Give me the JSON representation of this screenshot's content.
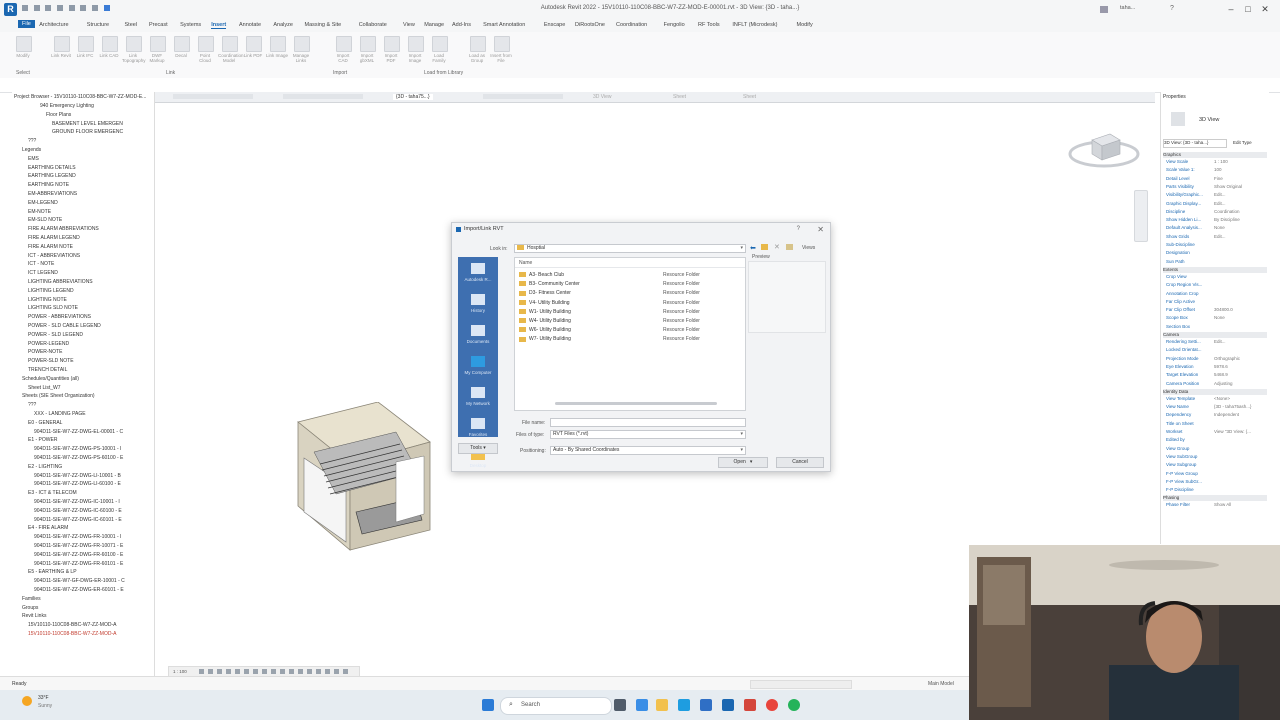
{
  "app": {
    "logo": "R",
    "window_title": "Autodesk Revit 2022 - 15V10110-110C08-BBC-W7-ZZ-MOD-E-00001.rvt - 3D View: {3D - taha...}",
    "user": "taha..."
  },
  "ribbon_tabs": [
    "File",
    "Architecture",
    "Structure",
    "Steel",
    "Precast",
    "Systems",
    "Insert",
    "Annotate",
    "Analyze",
    "Massing & Site",
    "Collaborate",
    "View",
    "Manage",
    "Add-Ins",
    "Smart Annotation",
    "Enscape",
    "DiRootsOne",
    "Coordination",
    "Fengolio",
    "RF Tools",
    "INFLT (Microdesk)",
    "Modify"
  ],
  "ribbon_active_tab": "Insert",
  "ribbon_groups": {
    "select": "Select",
    "link": "Link",
    "import": "Import",
    "load": "Load from Library"
  },
  "ribbon_tools": [
    "Modify",
    "Link Revit",
    "Link IFC",
    "Link CAD",
    "Link Topography",
    "DWF Markup",
    "Decal",
    "Point Cloud",
    "Coordination Model",
    "Link PDF",
    "Link Image",
    "Manage Links",
    "Import CAD",
    "Import gbXML",
    "Import PDF",
    "Import Image",
    "Load Family",
    "Load as Group",
    "Insert from File"
  ],
  "view_tabs": [
    "{3D - taha75...}",
    "3D View",
    "Sheet"
  ],
  "project_browser": {
    "title": "Project Browser - 15V10110-110C08-BBC-W7-ZZ-MOD-E...",
    "items": [
      {
        "label": "940 Emergency Lighting",
        "indent": 4,
        "red": false
      },
      {
        "label": "Floor Plans",
        "indent": 5,
        "red": false
      },
      {
        "label": "BASEMENT LEVEL EMERGEN",
        "indent": 6,
        "red": false
      },
      {
        "label": "GROUND FLOOR EMERGENC",
        "indent": 6,
        "red": false
      },
      {
        "label": "???",
        "indent": 2,
        "red": false
      },
      {
        "label": "Legends",
        "indent": 1,
        "red": false
      },
      {
        "label": "EMS",
        "indent": 2,
        "red": false
      },
      {
        "label": "EARTHING DETAILS",
        "indent": 2,
        "red": false
      },
      {
        "label": "EARTHING LEGEND",
        "indent": 2,
        "red": false
      },
      {
        "label": "EARTHING NOTE",
        "indent": 2,
        "red": false
      },
      {
        "label": "EM-ABBREVIATIONS",
        "indent": 2,
        "red": false
      },
      {
        "label": "EM-LEGEND",
        "indent": 2,
        "red": false
      },
      {
        "label": "EM-NOTE",
        "indent": 2,
        "red": false
      },
      {
        "label": "EM-SLD NOTE",
        "indent": 2,
        "red": false
      },
      {
        "label": "FIRE ALARM ABBREVIATIONS",
        "indent": 2,
        "red": false
      },
      {
        "label": "FIRE ALARM LEGEND",
        "indent": 2,
        "red": false
      },
      {
        "label": "FIRE ALARM NOTE",
        "indent": 2,
        "red": false
      },
      {
        "label": "ICT - ABBREVIATIONS",
        "indent": 2,
        "red": false
      },
      {
        "label": "ICT - NOTE",
        "indent": 2,
        "red": false
      },
      {
        "label": "ICT LEGEND",
        "indent": 2,
        "red": false
      },
      {
        "label": "LIGHTING ABBREVIATIONS",
        "indent": 2,
        "red": false
      },
      {
        "label": "LIGHTING LEGEND",
        "indent": 2,
        "red": false
      },
      {
        "label": "LIGHTING NOTE",
        "indent": 2,
        "red": false
      },
      {
        "label": "LIGHTING SLD NOTE",
        "indent": 2,
        "red": false
      },
      {
        "label": "POWER - ABBREVIATIONS",
        "indent": 2,
        "red": false
      },
      {
        "label": "POWER - SLD CABLE LEGEND",
        "indent": 2,
        "red": false
      },
      {
        "label": "POWER - SLD LEGEND",
        "indent": 2,
        "red": false
      },
      {
        "label": "POWER-LEGEND",
        "indent": 2,
        "red": false
      },
      {
        "label": "POWER-NOTE",
        "indent": 2,
        "red": false
      },
      {
        "label": "POWER-SLD NOTE",
        "indent": 2,
        "red": false
      },
      {
        "label": "TRENCH DETAIL",
        "indent": 2,
        "red": false
      },
      {
        "label": "Schedules/Quantities (all)",
        "indent": 1,
        "red": false
      },
      {
        "label": "Sheet List_W7",
        "indent": 2,
        "red": false
      },
      {
        "label": "Sheets (SIE Sheet Organization)",
        "indent": 1,
        "red": false
      },
      {
        "label": "???",
        "indent": 2,
        "red": false
      },
      {
        "label": "XXX - LANDING PAGE",
        "indent": 3,
        "red": false
      },
      {
        "label": "E0 - GENERAL",
        "indent": 2,
        "red": false
      },
      {
        "label": "904D11-SIE-W7-ZZ-DWG-EL-00001 - C",
        "indent": 3,
        "red": false
      },
      {
        "label": "E1 - POWER",
        "indent": 2,
        "red": false
      },
      {
        "label": "904D11-SIE-W7-ZZ-DWG-PS-10001 - I",
        "indent": 3,
        "red": false
      },
      {
        "label": "904D11-SIE-W7-ZZ-DWG-PS-60100 - E",
        "indent": 3,
        "red": false
      },
      {
        "label": "E2 - LIGHTING",
        "indent": 2,
        "red": false
      },
      {
        "label": "904D11-SIE-W7-ZZ-DWG-LI-10001 - B",
        "indent": 3,
        "red": false
      },
      {
        "label": "904D11-SIE-W7-ZZ-DWG-LI-60100 - E",
        "indent": 3,
        "red": false
      },
      {
        "label": "E3 - ICT & TELECOM",
        "indent": 2,
        "red": false
      },
      {
        "label": "904D11-SIE-W7-ZZ-DWG-IC-10001 - I",
        "indent": 3,
        "red": false
      },
      {
        "label": "904D11-SIE-W7-ZZ-DWG-IC-60100 - E",
        "indent": 3,
        "red": false
      },
      {
        "label": "904D11-SIE-W7-ZZ-DWG-IC-60101 - E",
        "indent": 3,
        "red": false
      },
      {
        "label": "E4 - FIRE ALARM",
        "indent": 2,
        "red": false
      },
      {
        "label": "904D11-SIE-W7-ZZ-DWG-FR-10001 - I",
        "indent": 3,
        "red": false
      },
      {
        "label": "904D11-SIE-W7-ZZ-DWG-FR-10071 - E",
        "indent": 3,
        "red": false
      },
      {
        "label": "904D11-SIE-W7-ZZ-DWG-FR-60100 - E",
        "indent": 3,
        "red": false
      },
      {
        "label": "904D11-SIE-W7-ZZ-DWG-FR-60101 - E",
        "indent": 3,
        "red": false
      },
      {
        "label": "E5 - EARTHING & LP",
        "indent": 2,
        "red": false
      },
      {
        "label": "904D11-SIE-W7-GF-DWG-ER-10001 - C",
        "indent": 3,
        "red": false
      },
      {
        "label": "904D11-SIE-W7-ZZ-DWG-ER-60101 - E",
        "indent": 3,
        "red": false
      },
      {
        "label": "Families",
        "indent": 1,
        "red": false
      },
      {
        "label": "Groups",
        "indent": 1,
        "red": false
      },
      {
        "label": "Revit Links",
        "indent": 1,
        "red": false
      },
      {
        "label": "15V10110-110C08-BBC-W7-ZZ-MOD-A",
        "indent": 2,
        "red": false
      },
      {
        "label": "15V10110-110C08-BBC-W7-ZZ-MOD-A",
        "indent": 2,
        "red": true
      }
    ]
  },
  "properties": {
    "title": "Properties",
    "type_name": "3D View",
    "selector": "3D View: {3D - taha...}",
    "edit_type": "Edit Type",
    "sections": [
      {
        "name": "Graphics",
        "rows": [
          [
            "View Scale",
            "1 : 100"
          ],
          [
            "Scale Value  1:",
            "100"
          ],
          [
            "Detail Level",
            "Fine"
          ],
          [
            "Parts Visibility",
            "Show Original"
          ],
          [
            "Visibility/Graphic...",
            "Edit..."
          ],
          [
            "Graphic Display...",
            "Edit..."
          ],
          [
            "Discipline",
            "Coordination"
          ],
          [
            "Show Hidden Li...",
            "By Discipline"
          ],
          [
            "Default Analysis...",
            "None"
          ],
          [
            "Show Grids",
            "Edit..."
          ],
          [
            "Sub-Discipline",
            ""
          ],
          [
            "Designation",
            ""
          ],
          [
            "Sun Path",
            ""
          ]
        ]
      },
      {
        "name": "Extents",
        "rows": [
          [
            "Crop View",
            ""
          ],
          [
            "Crop Region Vis...",
            ""
          ],
          [
            "Annotation Crop",
            ""
          ],
          [
            "Far Clip Active",
            ""
          ],
          [
            "Far Clip Offset",
            "304800.0"
          ],
          [
            "Scope Box",
            "None"
          ],
          [
            "Section Box",
            ""
          ]
        ]
      },
      {
        "name": "Camera",
        "rows": [
          [
            "Rendering Setti...",
            "Edit..."
          ],
          [
            "Locked Orientat...",
            ""
          ],
          [
            "Projection Mode",
            "Orthographic"
          ],
          [
            "Eye Elevation",
            "5978.6"
          ],
          [
            "Target Elevation",
            "5468.9"
          ],
          [
            "Camera Position",
            "Adjusting"
          ]
        ]
      },
      {
        "name": "Identity Data",
        "rows": [
          [
            "View Template",
            "<None>"
          ],
          [
            "View Name",
            "{3D - taha75ash...}"
          ],
          [
            "Dependency",
            "Independent"
          ],
          [
            "Title on Sheet",
            ""
          ],
          [
            "Workset",
            "View \"3D View: {..."
          ],
          [
            "Edited by",
            ""
          ],
          [
            "View Group",
            ""
          ],
          [
            "View SubGroup",
            ""
          ],
          [
            "View Subgroup",
            ""
          ],
          [
            "F-P View Group",
            ""
          ],
          [
            "F-P View SubGr...",
            ""
          ],
          [
            "F-P Discipline",
            ""
          ]
        ]
      },
      {
        "name": "Phasing",
        "rows": [
          [
            "Phase Filter",
            "Show All"
          ]
        ]
      }
    ]
  },
  "dialog": {
    "title": "Import/Link RVT",
    "help": "?",
    "close": "✕",
    "look_in_label": "Look in:",
    "look_in_value": "Hosptial",
    "preview_label": "Preview",
    "views_label": "Views",
    "places": [
      "Autodesk R...",
      "History",
      "Documents",
      "My Computer",
      "My Network",
      "Favorites",
      "Desktop"
    ],
    "col_name": "Name",
    "files": [
      {
        "name": "A3- Beach Club",
        "type": "Resource Folder"
      },
      {
        "name": "B3- Community Center",
        "type": "Resource Folder"
      },
      {
        "name": "D3- Fitness Center",
        "type": "Resource Folder"
      },
      {
        "name": "V4- Utility Building",
        "type": "Resource Folder"
      },
      {
        "name": "W1- Utility Building",
        "type": "Resource Folder"
      },
      {
        "name": "W4- Utility Building",
        "type": "Resource Folder"
      },
      {
        "name": "W6- Utility Building",
        "type": "Resource Folder"
      },
      {
        "name": "W7- Utility Building",
        "type": "Resource Folder"
      }
    ],
    "filename_label": "File name:",
    "filename_value": "",
    "filetype_label": "Files of type:",
    "filetype_value": "RVT Files (*.rvt)",
    "positioning_label": "Positioning:",
    "positioning_value": "Auto - By Shared Coordinates",
    "tools_label": "Tools",
    "open_label": "Open",
    "cancel_label": "Cancel"
  },
  "status": {
    "ready": "Ready",
    "scale": "1 : 100",
    "central": "Main Model"
  },
  "taskbar": {
    "weather_temp": "33°F",
    "weather_desc": "Sunny",
    "search": "Search"
  }
}
